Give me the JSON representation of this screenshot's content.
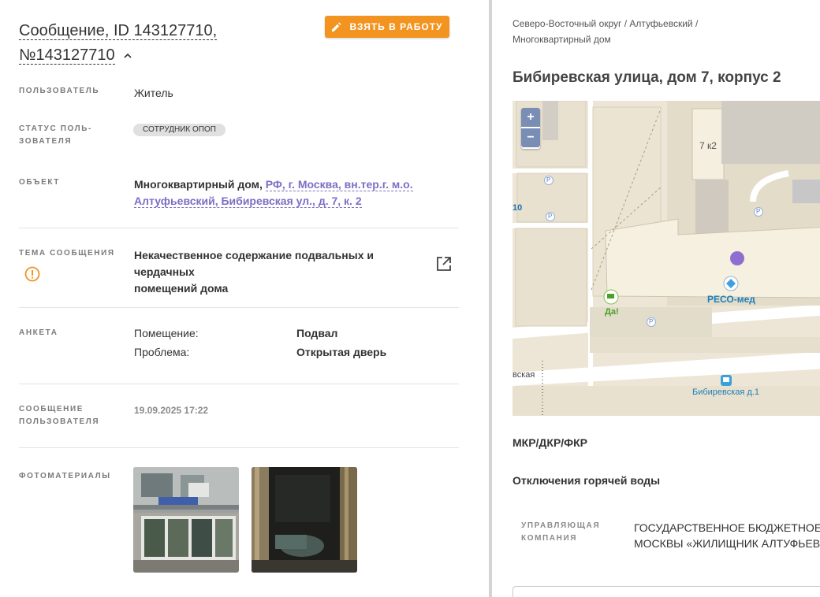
{
  "message": {
    "title_line1": "Сообщение, ID 143127710,",
    "title_line2": "№143127710",
    "take_button": "ВЗЯТЬ В РАБОТУ"
  },
  "fields": {
    "user_label": "ПОЛЬЗОВАТЕЛЬ",
    "user_value": "Житель",
    "status_label_1": "СТАТУС ПОЛЬ-",
    "status_label_2": "ЗОВАТЕЛЯ",
    "status_value": "СОТРУДНИК ОПОП",
    "object_label": "ОБЪЕКТ",
    "object_type": "Многоквартирный дом,",
    "object_addr_1": "РФ, г. Москва, вн.тер.г. м.о.",
    "object_addr_2": "Алтуфьевский, Бибиревская ул., д. 7, к. 2",
    "topic_label": "ТЕМА СООБЩЕНИЯ",
    "topic_value_1": "Некачественное содержание подвальных и чердачных",
    "topic_value_2": "помещений дома",
    "form_label": "АНКЕТА",
    "form_rows": [
      {
        "key": "Помещение:",
        "value": "Подвал"
      },
      {
        "key": "Проблема:",
        "value": "Открытая дверь"
      }
    ],
    "user_msg_label_1": "СООБЩЕНИЕ",
    "user_msg_label_2": "ПОЛЬЗОВАТЕЛЯ",
    "user_msg_date": "19.09.2025 17:22",
    "photos_label": "ФОТОМАТЕРИАЛЫ"
  },
  "right": {
    "crumb_1": "Северо-Восточный округ / Алтуфьевский /",
    "crumb_2": "Многоквартирный дом",
    "address": "Бибиревская улица, дом 7, корпус 2",
    "map": {
      "zoom_in": "+",
      "zoom_out": "−",
      "bldg_label": "7 к2",
      "poi_reso": "РЕСО-мед",
      "poi_da": "Да!",
      "bus_stop": "Бибиревская д.1",
      "street_partial": "вская",
      "house_partial": "10",
      "parking": "P"
    },
    "mkr_label": "МКР/ДКР/ФКР",
    "hot_water_label": "Отключения горячей воды",
    "mgmt_label_1": "УПРАВЛЯЮЩАЯ",
    "mgmt_label_2": "КОМПАНИЯ",
    "mgmt_value_1": "ГОСУДАРСТВЕННОЕ БЮДЖЕТНОЕ УЧ",
    "mgmt_value_2": "МОСКВЫ «ЖИЛИЩНИК АЛТУФЬЕВСК"
  },
  "colors": {
    "accent_orange": "#f39420",
    "link_purple": "#7b6fc4",
    "map_marker": "#8e6fd1"
  }
}
